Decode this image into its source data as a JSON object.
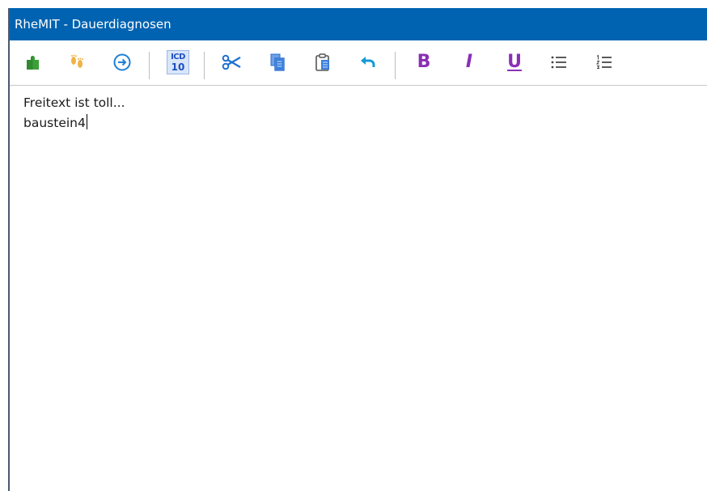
{
  "window": {
    "title": "RheMIT - Dauerdiagnosen"
  },
  "toolbar": {
    "buttons": [
      {
        "icon": "puzzle-icon",
        "color": "#3ba03a"
      },
      {
        "icon": "footprints-icon",
        "color": "#f0b347"
      },
      {
        "icon": "arrow-circle-right-icon",
        "color": "#1e7fd6"
      },
      {
        "icon": "icd10-icon",
        "label": "ICD 10",
        "color": "#1e4fc0"
      },
      {
        "icon": "scissors-icon",
        "color": "#1e6fd0"
      },
      {
        "icon": "copy-icon",
        "color": "#2a6ed1"
      },
      {
        "icon": "paste-icon",
        "color": "#2a6ed1"
      },
      {
        "icon": "undo-icon",
        "color": "#1599d6"
      },
      {
        "icon": "bold-icon",
        "label": "B",
        "color": "#8a2fb5"
      },
      {
        "icon": "italic-icon",
        "label": "I",
        "color": "#8a2fb5"
      },
      {
        "icon": "underline-icon",
        "label": "U",
        "color": "#8a2fb5"
      },
      {
        "icon": "bullet-list-icon",
        "color": "#444444"
      },
      {
        "icon": "numbered-list-icon",
        "color": "#444444"
      }
    ],
    "icd_top": "ICD",
    "icd_bottom": "10",
    "bold_label": "B",
    "italic_label": "I",
    "underline_label": "U"
  },
  "editor": {
    "lines": [
      "Freitext ist toll...",
      "baustein4"
    ]
  },
  "colors": {
    "titlebar": "#0063b1",
    "format_accent": "#8a2fb5"
  }
}
